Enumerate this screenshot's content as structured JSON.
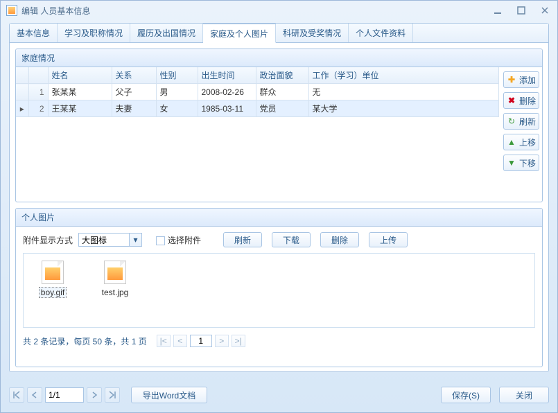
{
  "window": {
    "title": "编辑 人员基本信息"
  },
  "tabs": [
    "基本信息",
    "学习及职称情况",
    "履历及出国情况",
    "家庭及个人图片",
    "科研及受奖情况",
    "个人文件资料"
  ],
  "active_tab": 3,
  "family": {
    "title": "家庭情况",
    "columns": [
      "姓名",
      "关系",
      "性别",
      "出生时间",
      "政治面貌",
      "工作（学习）单位"
    ],
    "rows": [
      {
        "idx": "1",
        "name": "张某某",
        "relation": "父子",
        "gender": "男",
        "birth": "2008-02-26",
        "political": "群众",
        "workplace": "无",
        "current": false
      },
      {
        "idx": "2",
        "name": "王某某",
        "relation": "夫妻",
        "gender": "女",
        "birth": "1985-03-11",
        "political": "党员",
        "workplace": "某大学",
        "current": true
      }
    ],
    "buttons": {
      "add": "添加",
      "delete": "删除",
      "refresh": "刷新",
      "up": "上移",
      "down": "下移"
    }
  },
  "images": {
    "title": "个人图片",
    "display_label": "附件显示方式",
    "display_value": "大图标",
    "select_label": "选择附件",
    "tool_buttons": {
      "refresh": "刷新",
      "download": "下载",
      "delete": "删除",
      "upload": "上传"
    },
    "files": [
      {
        "name": "boy.gif",
        "selected": true
      },
      {
        "name": "test.jpg",
        "selected": false
      }
    ],
    "pager_text": "共 2 条记录，每页 50 条，共 1 页",
    "pager_page": "1"
  },
  "footer": {
    "nav_position": "1/1",
    "export": "导出Word文档",
    "save": "保存(S)",
    "close": "关闭"
  }
}
